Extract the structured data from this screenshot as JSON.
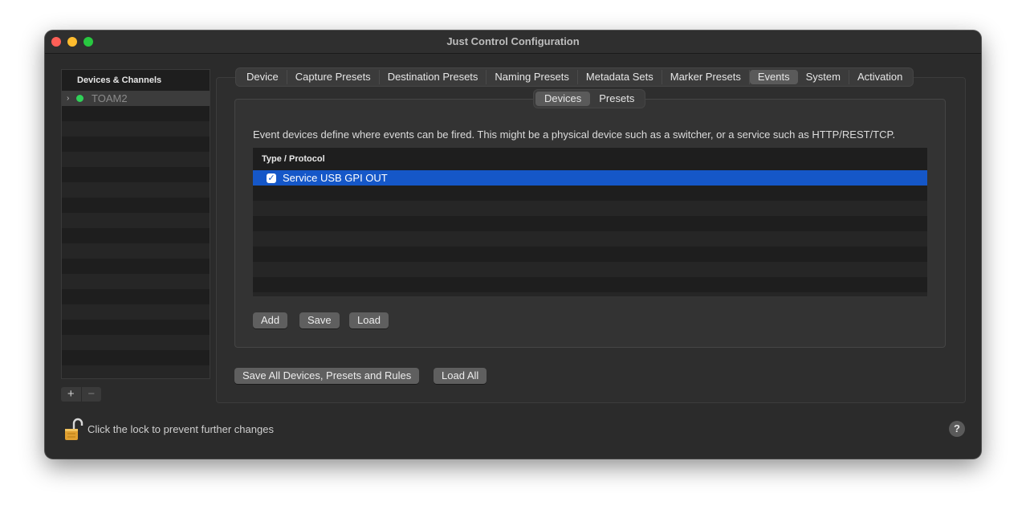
{
  "window": {
    "title": "Just Control Configuration"
  },
  "sidebar": {
    "header": "Devices & Channels",
    "items": [
      {
        "label": "TOAM2",
        "status_color": "#30d158"
      }
    ],
    "add_label": "+",
    "remove_label": "−"
  },
  "tabs": [
    {
      "label": "Device"
    },
    {
      "label": "Capture Presets"
    },
    {
      "label": "Destination Presets"
    },
    {
      "label": "Naming Presets"
    },
    {
      "label": "Metadata Sets"
    },
    {
      "label": "Marker Presets"
    },
    {
      "label": "Events",
      "active": true
    },
    {
      "label": "System"
    },
    {
      "label": "Activation"
    }
  ],
  "subtabs": [
    {
      "label": "Devices",
      "active": true
    },
    {
      "label": "Presets"
    }
  ],
  "events": {
    "description": "Event devices define where events can be fired. This might be a physical device such as a switcher, or a service such as HTTP/REST/TCP.",
    "table": {
      "column": "Type / Protocol",
      "rows": [
        {
          "label": "Service USB GPI OUT",
          "checked": true,
          "selected": true
        }
      ]
    },
    "buttons": {
      "add": "Add",
      "save": "Save",
      "load": "Load"
    }
  },
  "global_buttons": {
    "save_all": "Save All Devices, Presets and Rules",
    "load_all": "Load All"
  },
  "footer": {
    "lock_text": "Click the lock to prevent further changes",
    "help": "?"
  },
  "colors": {
    "selection": "#1557c8",
    "accent_green": "#30d158"
  }
}
